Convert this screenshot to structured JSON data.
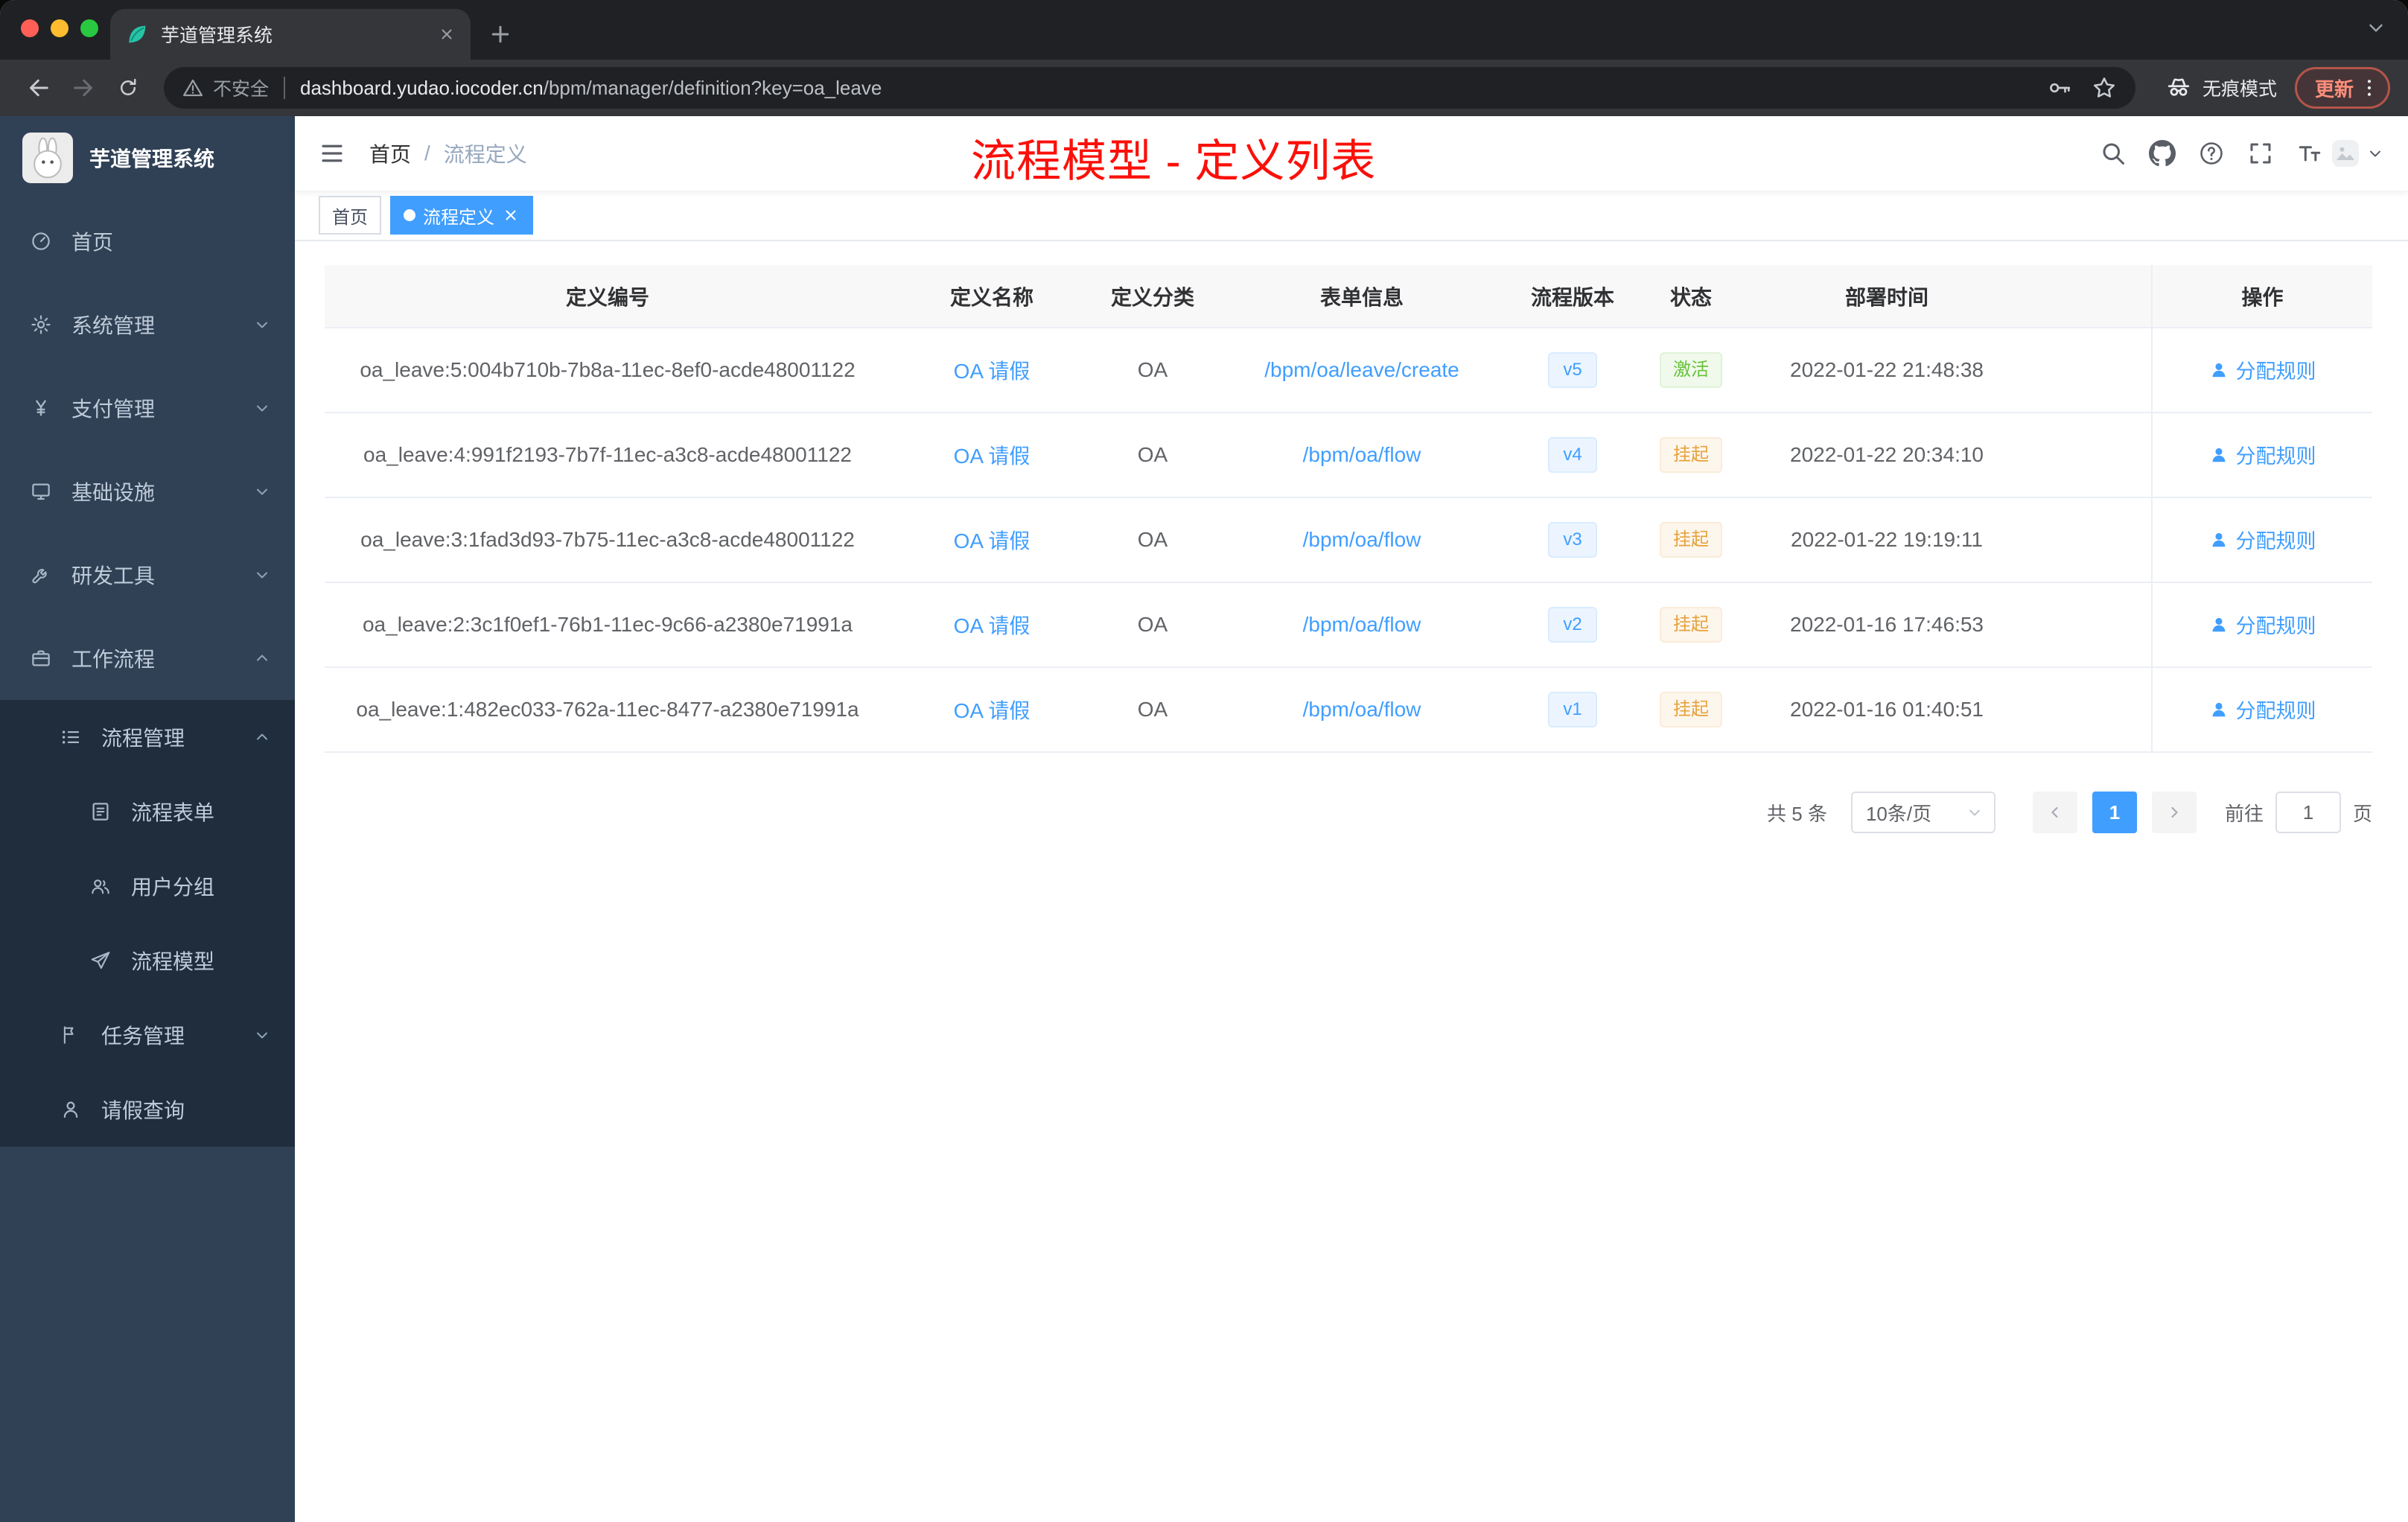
{
  "colors": {
    "accent": "#409EFF",
    "success": "#67C23A",
    "warning": "#E6A23C",
    "annotation_red": "#FB100A",
    "sidebar_bg": "#304156",
    "sidebar_submenu_bg": "#1F2D3D"
  },
  "browser": {
    "tab": {
      "title": "芋道管理系统",
      "favicon": "leaf-favicon"
    },
    "toolbar": {
      "security_label": "不安全",
      "url_host": "dashboard.yudao.iocoder.cn",
      "url_path": "/bpm/manager/definition?key=oa_leave",
      "incognito_label": "无痕模式",
      "update_label": "更新"
    }
  },
  "sidebar": {
    "logo_title": "芋道管理系统",
    "menu": [
      {
        "label": "首页",
        "icon": "dashboard-icon",
        "level": 0
      },
      {
        "label": "系统管理",
        "icon": "gear-icon",
        "level": 0,
        "arrow": "down"
      },
      {
        "label": "支付管理",
        "icon": "yen-icon",
        "level": 0,
        "arrow": "down"
      },
      {
        "label": "基础设施",
        "icon": "monitor-icon",
        "level": 0,
        "arrow": "down"
      },
      {
        "label": "研发工具",
        "icon": "wrench-icon",
        "level": 0,
        "arrow": "down"
      },
      {
        "label": "工作流程",
        "icon": "briefcase-icon",
        "level": 0,
        "arrow": "up"
      },
      {
        "label": "流程管理",
        "icon": "list-icon",
        "level": 1,
        "arrow": "up",
        "dark": true
      },
      {
        "label": "流程表单",
        "icon": "form-icon",
        "level": 2,
        "dark": true
      },
      {
        "label": "用户分组",
        "icon": "group-icon",
        "level": 2,
        "dark": true
      },
      {
        "label": "流程模型",
        "icon": "paper-plane-icon",
        "level": 2,
        "dark": true
      },
      {
        "label": "任务管理",
        "icon": "flag-icon",
        "level": 1,
        "arrow": "down",
        "dark": true
      },
      {
        "label": "请假查询",
        "icon": "user-icon",
        "level": 1,
        "dark": true
      }
    ]
  },
  "navbar": {
    "breadcrumb": [
      {
        "label": "首页"
      },
      {
        "label": "流程定义"
      }
    ],
    "breadcrumb_separator": "/",
    "annotation": "流程模型 - 定义列表",
    "actions": [
      "search-icon",
      "github-icon",
      "question-icon",
      "fullscreen-icon",
      "font-size-icon"
    ]
  },
  "tags": [
    {
      "label": "首页",
      "active": false,
      "closable": false
    },
    {
      "label": "流程定义",
      "active": true,
      "closable": true
    }
  ],
  "table": {
    "columns": [
      "定义编号",
      "定义名称",
      "定义分类",
      "表单信息",
      "流程版本",
      "状态",
      "部署时间",
      "操作"
    ],
    "rows": [
      {
        "id": "oa_leave:5:004b710b-7b8a-11ec-8ef0-acde48001122",
        "name": "OA 请假",
        "category": "OA",
        "form": "/bpm/oa/leave/create",
        "version": "v5",
        "status": "激活",
        "status_type": "success",
        "deploy_time": "2022-01-22 21:48:38",
        "action": "分配规则"
      },
      {
        "id": "oa_leave:4:991f2193-7b7f-11ec-a3c8-acde48001122",
        "name": "OA 请假",
        "category": "OA",
        "form": "/bpm/oa/flow",
        "version": "v4",
        "status": "挂起",
        "status_type": "warning",
        "deploy_time": "2022-01-22 20:34:10",
        "action": "分配规则"
      },
      {
        "id": "oa_leave:3:1fad3d93-7b75-11ec-a3c8-acde48001122",
        "name": "OA 请假",
        "category": "OA",
        "form": "/bpm/oa/flow",
        "version": "v3",
        "status": "挂起",
        "status_type": "warning",
        "deploy_time": "2022-01-22 19:19:11",
        "action": "分配规则"
      },
      {
        "id": "oa_leave:2:3c1f0ef1-76b1-11ec-9c66-a2380e71991a",
        "name": "OA 请假",
        "category": "OA",
        "form": "/bpm/oa/flow",
        "version": "v2",
        "status": "挂起",
        "status_type": "warning",
        "deploy_time": "2022-01-16 17:46:53",
        "action": "分配规则"
      },
      {
        "id": "oa_leave:1:482ec033-762a-11ec-8477-a2380e71991a",
        "name": "OA 请假",
        "category": "OA",
        "form": "/bpm/oa/flow",
        "version": "v1",
        "status": "挂起",
        "status_type": "warning",
        "deploy_time": "2022-01-16 01:40:51",
        "action": "分配规则"
      }
    ]
  },
  "pagination": {
    "total_label": "共 5 条",
    "page_size_label": "10条/页",
    "current_page": "1",
    "goto_label": "前往",
    "goto_value": "1",
    "page_unit": "页"
  }
}
